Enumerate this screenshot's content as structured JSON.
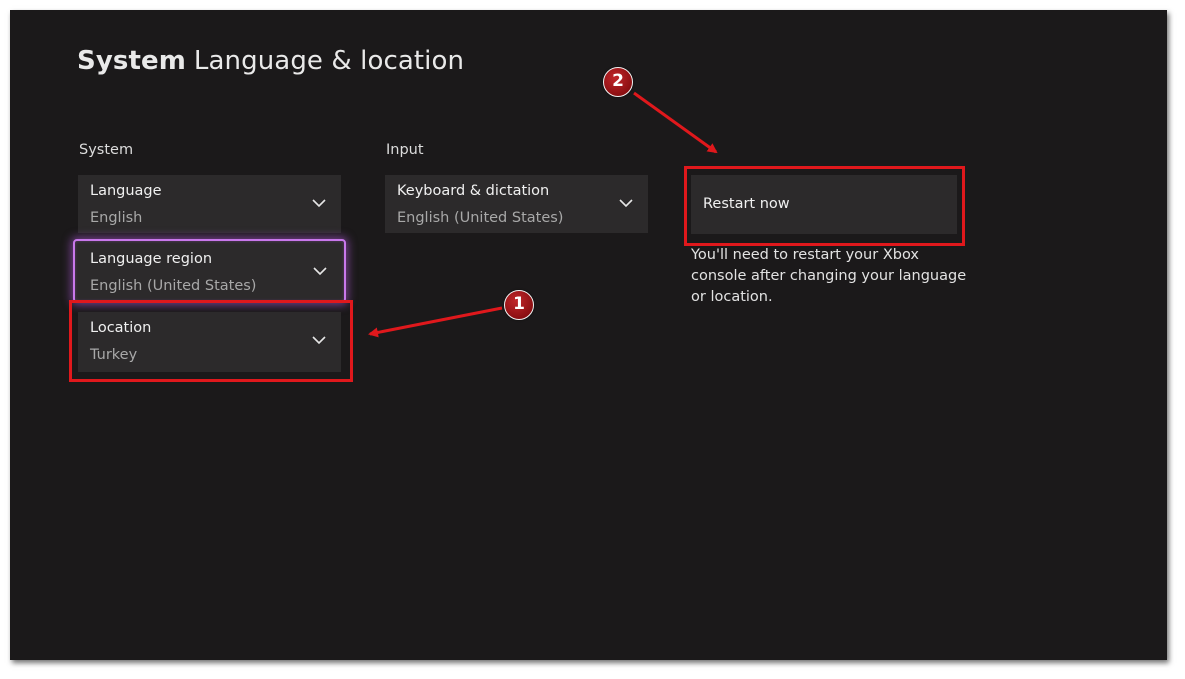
{
  "header": {
    "section": "System",
    "page": "Language & location"
  },
  "system_column": {
    "label": "System",
    "tiles": [
      {
        "label": "Language",
        "value": "English"
      },
      {
        "label": "Language region",
        "value": "English (United States)"
      },
      {
        "label": "Location",
        "value": "Turkey"
      }
    ]
  },
  "input_column": {
    "label": "Input",
    "tiles": [
      {
        "label": "Keyboard & dictation",
        "value": "English (United States)"
      }
    ]
  },
  "restart": {
    "label": "Restart now",
    "note": "You'll need to restart your Xbox console after changing your language or location."
  },
  "annotations": {
    "badge_1": "1",
    "badge_2": "2",
    "color": "#e0181c"
  },
  "icons": {
    "tile_dropdown": "chevron-down-icon"
  },
  "colors": {
    "background": "#1b191a",
    "tile": "#2c2a2b",
    "focus_glow": "#c978ec"
  }
}
